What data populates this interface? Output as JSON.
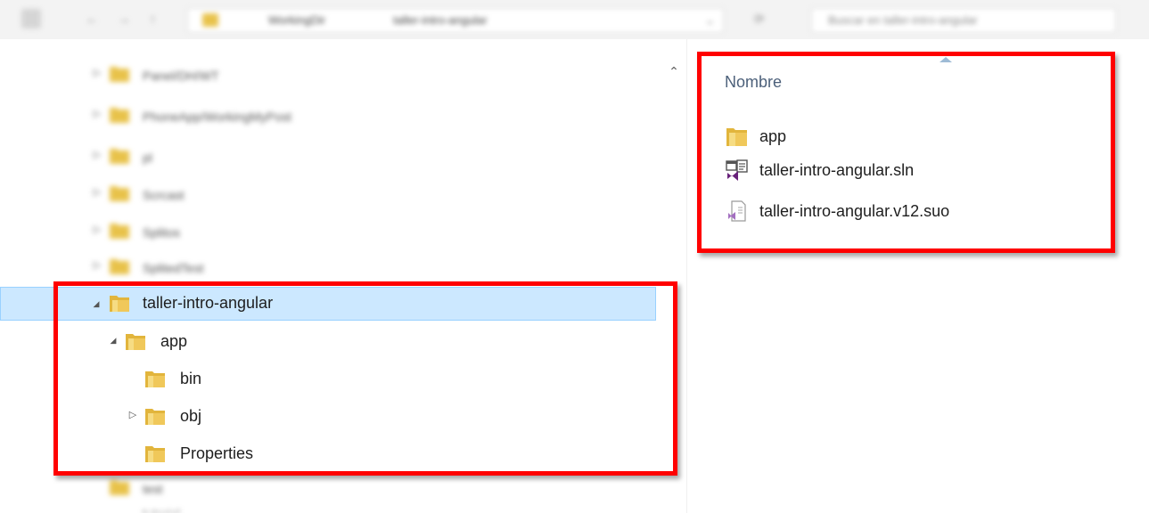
{
  "address_bar": {
    "path": [
      "WorkingDir",
      "taller-intro-angular"
    ],
    "search_placeholder": "Buscar en taller-intro-angular"
  },
  "tree": {
    "blurred_items": [
      {
        "label": "Panel/DH/WT"
      },
      {
        "label": "PhoneApp/WorkingMyPost"
      },
      {
        "label": "pl"
      },
      {
        "label": "Scrcast"
      },
      {
        "label": "Splitos"
      },
      {
        "label": "SplitedTest"
      }
    ],
    "items": [
      {
        "label": "taller-intro-angular",
        "expander": "◢",
        "selected": true
      },
      {
        "label": "app",
        "expander": "◢"
      },
      {
        "label": "bin",
        "expander": ""
      },
      {
        "label": "obj",
        "expander": "▷"
      },
      {
        "label": "Properties",
        "expander": ""
      }
    ],
    "blurred_bottom": [
      {
        "label": "test"
      },
      {
        "label": "tutorial"
      }
    ]
  },
  "list": {
    "column_header": "Nombre",
    "files": [
      {
        "name": "app",
        "icon": "folder-icon"
      },
      {
        "name": "taller-intro-angular.sln",
        "icon": "vs-solution-icon"
      },
      {
        "name": "taller-intro-angular.v12.suo",
        "icon": "vs-suo-file-icon"
      }
    ]
  },
  "colors": {
    "highlight": "#ff0000",
    "selection_bg": "#cce8ff",
    "header_text": "#4c607a",
    "folder": "#e8c24a"
  }
}
